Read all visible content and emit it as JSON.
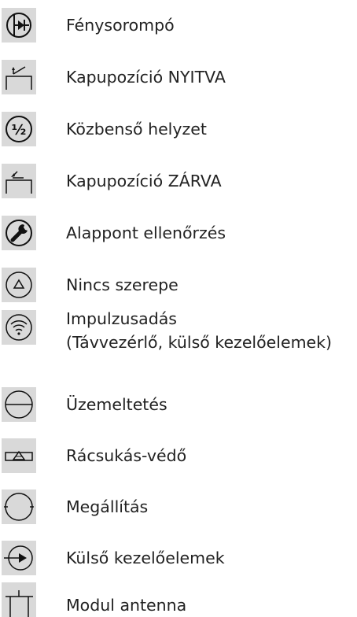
{
  "legend": {
    "items": [
      {
        "icon": "photo-eye-icon",
        "label": "Fénysorompó"
      },
      {
        "icon": "gate-open-icon",
        "label": "Kapupozíció NYITVA"
      },
      {
        "icon": "half-position-icon",
        "label": "Közbenső helyzet"
      },
      {
        "icon": "gate-closed-icon",
        "label": "Kapupozíció ZÁRVA"
      },
      {
        "icon": "wrench-icon",
        "label": "Alappont ellenőrzés"
      },
      {
        "icon": "triangle-icon",
        "label": "Nincs szerepe"
      },
      {
        "icon": "wireless-icon",
        "label": "Impulzusadás",
        "label2": "(Távvezérlő, külső kezelőelemek)"
      },
      {
        "icon": "operation-icon",
        "label": "Üzemeltetés"
      },
      {
        "icon": "closing-edge-icon",
        "label": "Rácsukás-védő"
      },
      {
        "icon": "stop-icon",
        "label": "Megállítás"
      },
      {
        "icon": "external-controls-icon",
        "label": "Külső kezelőelemek"
      },
      {
        "icon": "antenna-module-icon",
        "label": "Modul antenna"
      }
    ]
  }
}
